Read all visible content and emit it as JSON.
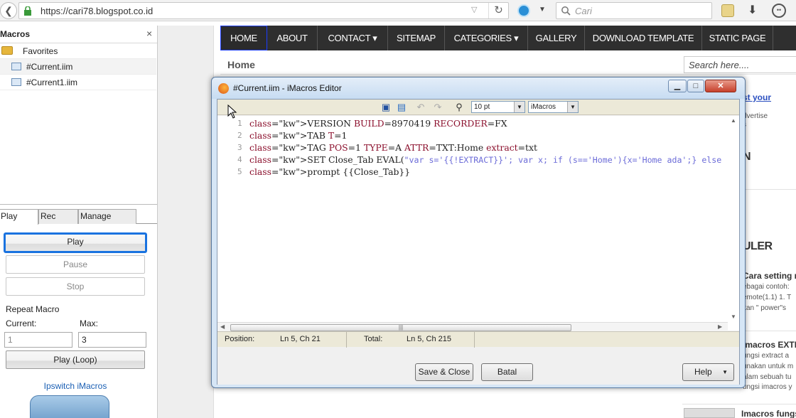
{
  "browser": {
    "url": "https://cari78.blogspot.co.id",
    "search_placeholder": "Cari"
  },
  "sidebar": {
    "title": "Macros",
    "close": "×",
    "tree": [
      {
        "label": "Favorites",
        "type": "folder"
      },
      {
        "label": "#Current.iim",
        "type": "file"
      },
      {
        "label": "#Current1.iim",
        "type": "file"
      }
    ],
    "tabs": [
      "Play",
      "Rec",
      "Manage"
    ],
    "play_button": "Play",
    "pause_button": "Pause",
    "stop_button": "Stop",
    "repeat_label": "Repeat Macro",
    "current_label": "Current:",
    "max_label": "Max:",
    "current_value": "1",
    "max_value": "3",
    "play_loop_button": "Play (Loop)",
    "link": "Ipswitch iMacros"
  },
  "site": {
    "nav": [
      "HOME",
      "ABOUT",
      "CONTACT ▾",
      "SITEMAP",
      "CATEGORIES ▾",
      "GALLERY",
      "DOWNLOAD TEMPLATE",
      "STATIC PAGE"
    ],
    "breadcrumb": "Home",
    "search_placeholder": "Search here....",
    "side_texts": {
      "link1": "st your",
      "t1": "dvertise",
      "t2": "s",
      "heading1": "N",
      "heading2": "ULER",
      "p1_title": "Cara setting m",
      "p1_l1": "ebagai contoh:",
      "p1_l2": "emote(1.1) 1. T",
      "p1_l3": "kan \" power\"s",
      "p2_title": "imacros EXTR",
      "p2_l1": "ungsi extract a",
      "p2_l2": "unakan untuk m",
      "p2_l3": "alam sebuah tu",
      "p2_l4": "ungsi imacros y",
      "p3_title": "Imacros fungs"
    }
  },
  "editor": {
    "title": "#Current.iim - iMacros Editor",
    "font_size": "10 pt",
    "highlighter": "iMacros",
    "lines": [
      "VERSION BUILD=8970419 RECORDER=FX",
      "TAB T=1",
      "TAG POS=1 TYPE=A ATTR=TXT:Home extract=txt",
      "SET Close_Tab EVAL(\"var s='{{!EXTRACT}}'; var x; if (s=='Home'){x='Home ada';} else",
      "prompt {{Close_Tab}}"
    ],
    "line_numbers": [
      "1",
      "2",
      "3",
      "4",
      "5"
    ],
    "status": {
      "position_label": "Position:",
      "position_value": "Ln 5, Ch 21",
      "total_label": "Total:",
      "total_value": "Ln 5, Ch 215"
    },
    "buttons": {
      "save_close": "Save & Close",
      "cancel": "Batal",
      "help": "Help"
    }
  },
  "icons": [
    "back-arrow-icon",
    "lock-icon",
    "reload-icon",
    "search-icon",
    "download-icon",
    "smiley-icon",
    "folder-icon",
    "file-icon",
    "firefox-icon",
    "save-icon",
    "open-icon",
    "undo-icon",
    "redo-icon",
    "find-icon"
  ]
}
